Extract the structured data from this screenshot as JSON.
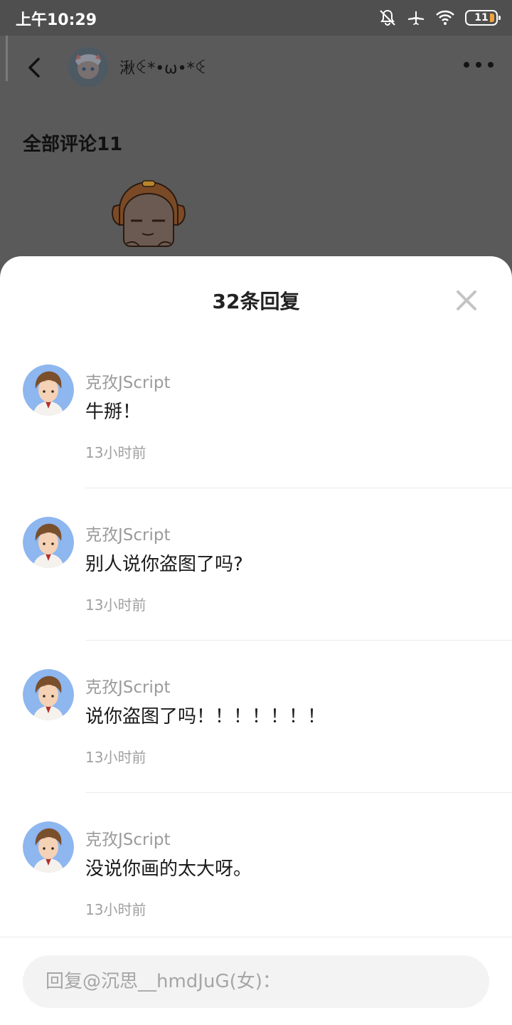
{
  "status_bar": {
    "time": "上午10:29",
    "battery": "11"
  },
  "header": {
    "author_name": "湫ꒊ*•ω•*ꒊ",
    "section_title": "全部评论11"
  },
  "sheet": {
    "title": "32条回复",
    "replies": [
      {
        "username": "克孜JScript",
        "content": "牛掰！",
        "time": "13小时前"
      },
      {
        "username": "克孜JScript",
        "content": "别人说你盗图了吗?",
        "time": "13小时前"
      },
      {
        "username": "克孜JScript",
        "content": "说你盗图了吗！！！！！！！",
        "time": "13小时前"
      },
      {
        "username": "克孜JScript",
        "content": "没说你画的太大呀。",
        "time": "13小时前"
      }
    ],
    "input_placeholder": "回复@沉思__hmdJuG(女)："
  },
  "colors": {
    "accent_orange": "#e78a36",
    "overlay": "#5a5a5a",
    "sheet_bg": "#ffffff"
  }
}
